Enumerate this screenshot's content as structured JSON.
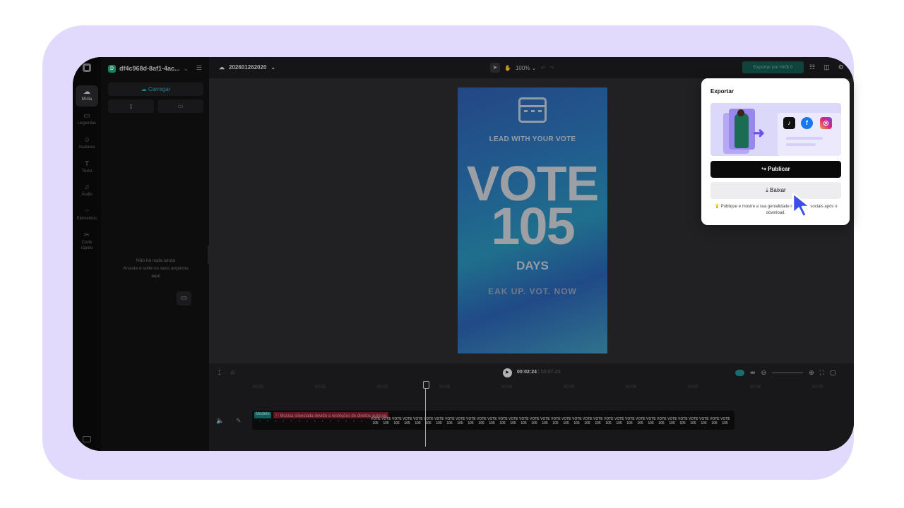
{
  "project": {
    "initial": "D",
    "name": "df4c968d-8af1-4ac...",
    "menu_icon": "list-icon"
  },
  "rail": {
    "items": [
      {
        "label": "Mídia",
        "icon": "☁"
      },
      {
        "label": "Legendas",
        "icon": "▭"
      },
      {
        "label": "Avatares",
        "icon": "☺"
      },
      {
        "label": "Texto",
        "icon": "T"
      },
      {
        "label": "Áudio",
        "icon": "♫"
      },
      {
        "label": "Elementos",
        "icon": "⁘"
      },
      {
        "label": "Corte rápido",
        "icon": "✂"
      }
    ]
  },
  "media_panel": {
    "upload_label": "Carregar",
    "empty_line1": "Não há nada ainda",
    "empty_line2": "Arraste e solte os seus arquivos",
    "empty_line3": "aqui"
  },
  "topbar": {
    "title": "202601262020",
    "zoom": "100%",
    "export_label": "Exportar por HK$ 0"
  },
  "poster": {
    "lead": "LEAD WITH YOUR VOTE",
    "vote": "VOTE",
    "number": "105",
    "days": "DAYS",
    "speak": "EAK UP. VOT. NOW"
  },
  "timeline": {
    "current_time": "00:02:24",
    "total_time": "00:07:23",
    "ruler": [
      "00:00",
      "00:01",
      "00:02",
      "00:03",
      "00:04",
      "00:05",
      "00:06",
      "00:07",
      "00:08",
      "00:09"
    ],
    "clip_tag": "Modelo",
    "clip_warning": "ⓘ Música silenciada devido a restrições de direitos autorais",
    "thumb_text": "VOTE 105"
  },
  "export_popup": {
    "title": "Exportar",
    "publish_label": "Publicar",
    "download_label": "Baixar",
    "note": "💡 Publique e mostre a sua genialidade nas redes sociais após o download."
  },
  "colors": {
    "accent": "#28a9b5",
    "backdrop": "#e2dafc",
    "cursor": "#3b4ee8"
  }
}
